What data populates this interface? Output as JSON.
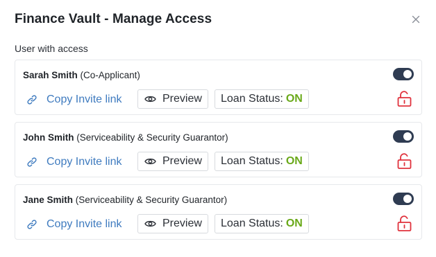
{
  "dialog": {
    "title": "Finance Vault - Manage Access",
    "section_label": "User with access"
  },
  "users": [
    {
      "name": "Sarah Smith",
      "role": "(Co-Applicant)",
      "toggle_on": true,
      "locked": false
    },
    {
      "name": "John Smith",
      "role": "(Serviceability & Security Guarantor)",
      "toggle_on": true,
      "locked": false
    },
    {
      "name": "Jane Smith",
      "role": "(Serviceability & Security Guarantor)",
      "toggle_on": true,
      "locked": false
    }
  ],
  "actions": {
    "copy_invite_label": "Copy Invite link",
    "preview_label": "Preview",
    "loan_status_label": "Loan Status:",
    "loan_status_value": "ON"
  },
  "icons": {
    "close": "close-icon",
    "link": "link-icon",
    "eye": "eye-icon",
    "lock": "unlocked-padlock-icon"
  },
  "colors": {
    "link": "#3f7bbf",
    "toggle": "#2f3c52",
    "status_on": "#6aa91a",
    "lock": "#e0323d"
  }
}
